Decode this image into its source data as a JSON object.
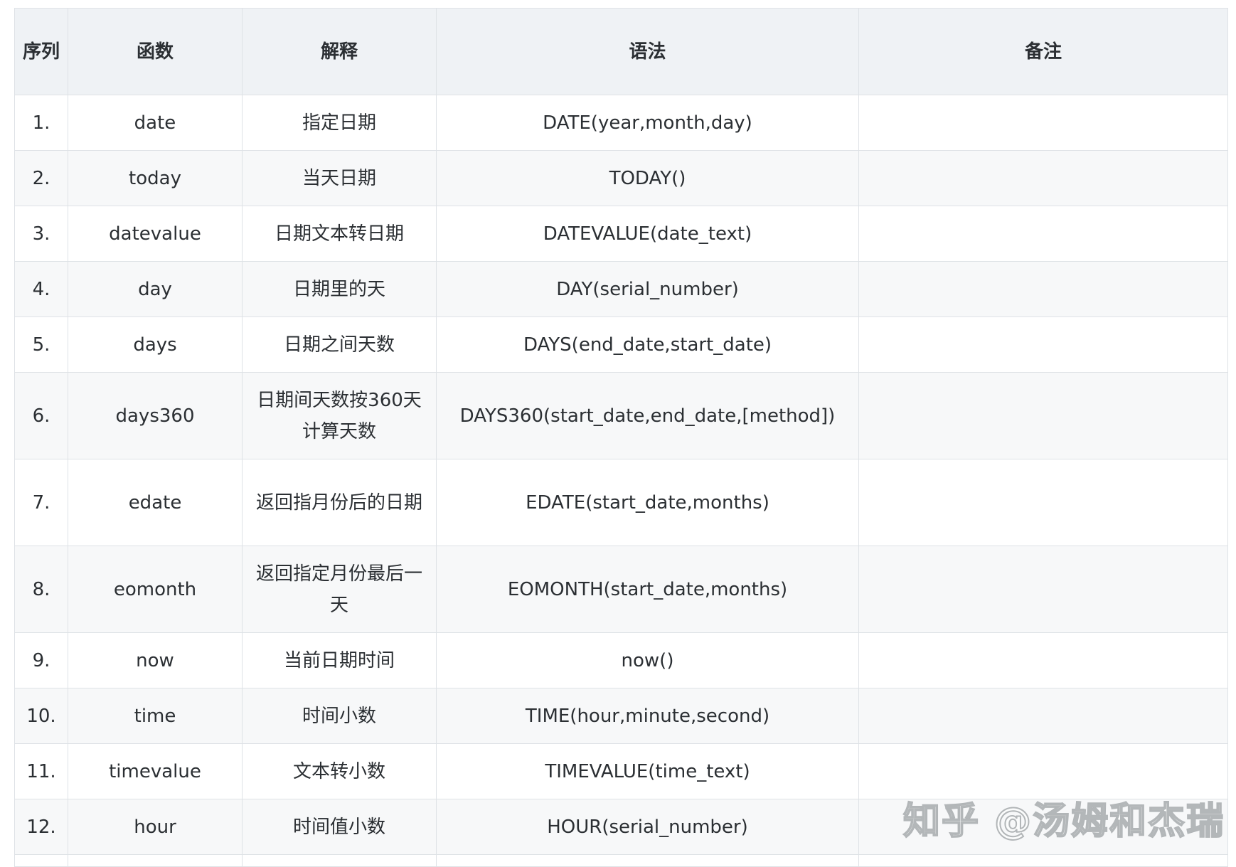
{
  "table": {
    "headers": {
      "index": "序列",
      "function": "函数",
      "description": "解释",
      "syntax": "语法",
      "notes": "备注"
    },
    "rows": [
      {
        "index": "1.",
        "function": "date",
        "description": "指定日期",
        "syntax": "DATE(year,month,day)",
        "notes": ""
      },
      {
        "index": "2.",
        "function": "today",
        "description": "当天日期",
        "syntax": "TODAY()",
        "notes": ""
      },
      {
        "index": "3.",
        "function": "datevalue",
        "description": "日期文本转日期",
        "syntax": "DATEVALUE(date_text)",
        "notes": ""
      },
      {
        "index": "4.",
        "function": "day",
        "description": "日期里的天",
        "syntax": "DAY(serial_number)",
        "notes": ""
      },
      {
        "index": "5.",
        "function": "days",
        "description": "日期之间天数",
        "syntax": "DAYS(end_date,start_date)",
        "notes": ""
      },
      {
        "index": "6.",
        "function": "days360",
        "description": "日期间天数按360天计算天数",
        "syntax": "DAYS360(start_date,end_date,[method])",
        "notes": ""
      },
      {
        "index": "7.",
        "function": "edate",
        "description": "返回指月份后的日期",
        "syntax": "EDATE(start_date,months)",
        "notes": ""
      },
      {
        "index": "8.",
        "function": "eomonth",
        "description": "返回指定月份最后一天",
        "syntax": "EOMONTH(start_date,months)",
        "notes": ""
      },
      {
        "index": "9.",
        "function": "now",
        "description": "当前日期时间",
        "syntax": "now()",
        "notes": ""
      },
      {
        "index": "10.",
        "function": "time",
        "description": "时间小数",
        "syntax": "TIME(hour,minute,second)",
        "notes": ""
      },
      {
        "index": "11.",
        "function": "timevalue",
        "description": "文本转小数",
        "syntax": "TIMEVALUE(time_text)",
        "notes": ""
      },
      {
        "index": "12.",
        "function": "hour",
        "description": "时间值小数",
        "syntax": "HOUR(serial_number)",
        "notes": ""
      }
    ]
  },
  "watermark": "知乎 @汤姆和杰瑞"
}
